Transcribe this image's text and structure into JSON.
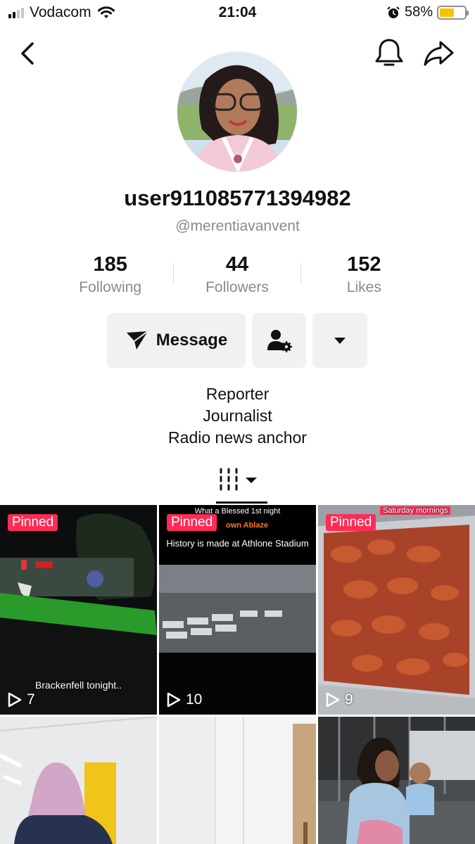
{
  "status_bar": {
    "carrier": "Vodacom",
    "time": "21:04",
    "battery_pct": "58%",
    "battery_level": 0.58
  },
  "profile": {
    "username": "user911085771394982",
    "handle": "@merentiavanvent",
    "stats": [
      {
        "value": "185",
        "label": "Following"
      },
      {
        "value": "44",
        "label": "Followers"
      },
      {
        "value": "152",
        "label": "Likes"
      }
    ],
    "message_label": "Message",
    "bio": [
      "Reporter",
      "Journalist",
      "Radio news anchor"
    ]
  },
  "videos": [
    {
      "pinned": "Pinned",
      "views": "7",
      "caption": "Brackenfell tonight.."
    },
    {
      "pinned": "Pinned",
      "views": "10",
      "caption_top": "What a Blessed 1st night",
      "caption_orange": "own Ablaze",
      "caption_main": "History is made at Athlone Stadium"
    },
    {
      "pinned": "Pinned",
      "views": "9",
      "caption_top": "Saturday mornings"
    },
    {},
    {},
    {}
  ],
  "colors": {
    "accent": "#fe2c55",
    "button_bg": "#f1f1f2",
    "muted_text": "#8a8a8a"
  }
}
